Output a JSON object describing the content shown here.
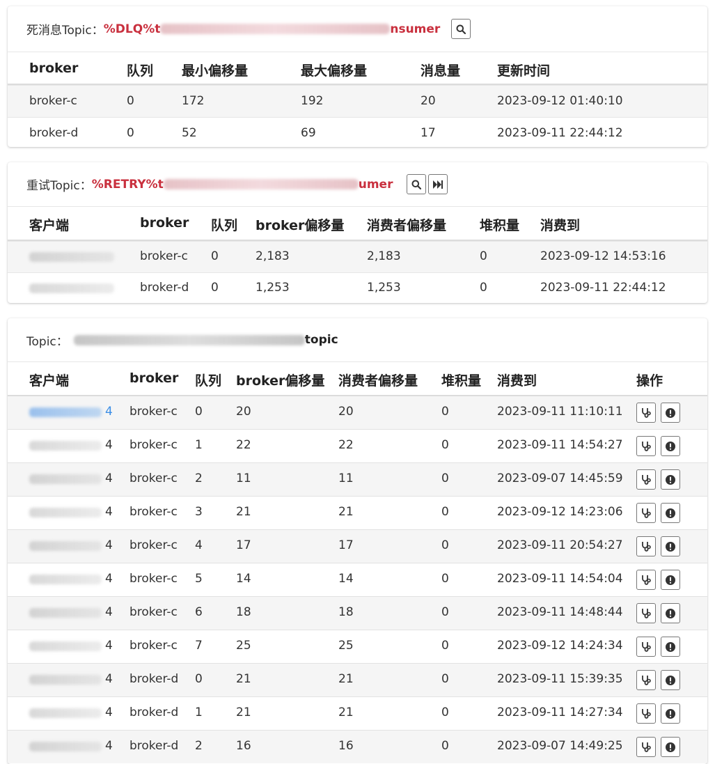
{
  "dlq": {
    "label": "死消息Topic：",
    "topic_prefix": "%DLQ%t",
    "topic_suffix": "nsumer",
    "search_icon": "search-icon",
    "columns": [
      "broker",
      "队列",
      "最小偏移量",
      "最大偏移量",
      "消息量",
      "更新时间"
    ],
    "rows": [
      [
        "broker-c",
        "0",
        "172",
        "192",
        "20",
        "2023-09-12 01:40:10"
      ],
      [
        "broker-d",
        "0",
        "52",
        "69",
        "17",
        "2023-09-11 22:44:12"
      ]
    ]
  },
  "retry": {
    "label": "重试Topic：",
    "topic_prefix": "%RETRY%t",
    "topic_suffix": "umer",
    "search_icon": "search-icon",
    "skip_icon": "fast-forward-icon",
    "columns": [
      "客户端",
      "broker",
      "队列",
      "broker偏移量",
      "消费者偏移量",
      "堆积量",
      "消费到"
    ],
    "rows": [
      [
        "",
        "broker-c",
        "0",
        "2,183",
        "2,183",
        "0",
        "2023-09-12 14:53:16"
      ],
      [
        "",
        "broker-d",
        "0",
        "1,253",
        "1,253",
        "0",
        "2023-09-11 22:44:12"
      ]
    ]
  },
  "topic": {
    "label": "Topic：",
    "topic_suffix": "topic",
    "columns": [
      "客户端",
      "broker",
      "队列",
      "broker偏移量",
      "消费者偏移量",
      "堆积量",
      "消费到",
      "操作"
    ],
    "op_icons": [
      "stethoscope-icon",
      "exclamation-icon"
    ],
    "ip_suffix": "4",
    "rows": [
      [
        "broker-c",
        "0",
        "20",
        "20",
        "0",
        "2023-09-11 11:10:11"
      ],
      [
        "broker-c",
        "1",
        "22",
        "22",
        "0",
        "2023-09-11 14:54:27"
      ],
      [
        "broker-c",
        "2",
        "11",
        "11",
        "0",
        "2023-09-07 14:45:59"
      ],
      [
        "broker-c",
        "3",
        "21",
        "21",
        "0",
        "2023-09-12 14:23:06"
      ],
      [
        "broker-c",
        "4",
        "17",
        "17",
        "0",
        "2023-09-11 20:54:27"
      ],
      [
        "broker-c",
        "5",
        "14",
        "14",
        "0",
        "2023-09-11 14:54:04"
      ],
      [
        "broker-c",
        "6",
        "18",
        "18",
        "0",
        "2023-09-11 14:48:44"
      ],
      [
        "broker-c",
        "7",
        "25",
        "25",
        "0",
        "2023-09-12 14:24:34"
      ],
      [
        "broker-d",
        "0",
        "21",
        "21",
        "0",
        "2023-09-11 15:39:35"
      ],
      [
        "broker-d",
        "1",
        "21",
        "21",
        "0",
        "2023-09-11 14:27:34"
      ],
      [
        "broker-d",
        "2",
        "16",
        "16",
        "0",
        "2023-09-07 14:49:25"
      ]
    ]
  },
  "colors": {
    "highlight": "#c9303e",
    "link": "#3b8ee6",
    "stripe": "#f5f5f5"
  }
}
